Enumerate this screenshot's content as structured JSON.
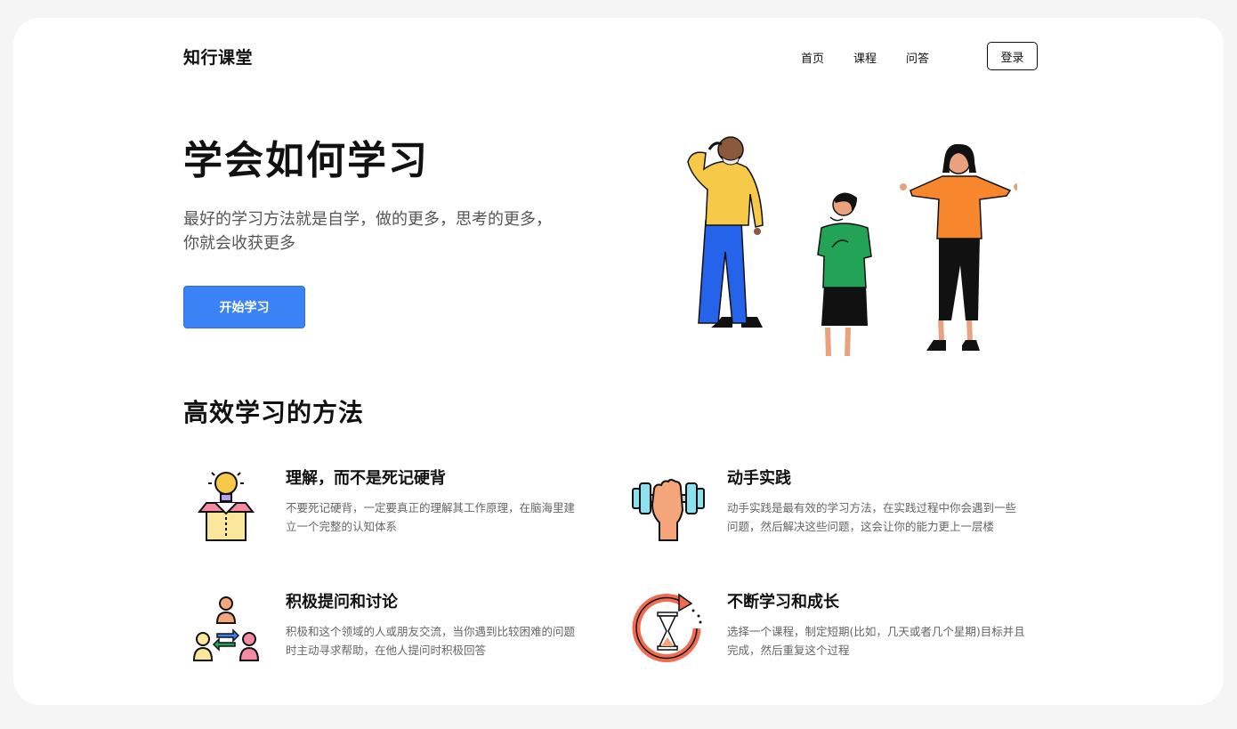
{
  "header": {
    "logo": "知行课堂",
    "nav": [
      {
        "label": "首页"
      },
      {
        "label": "课程"
      },
      {
        "label": "问答"
      }
    ],
    "login_label": "登录"
  },
  "hero": {
    "title": "学会如何学习",
    "subtitle_line1": "最好的学习方法就是自学，做的更多，思考的更多，",
    "subtitle_line2": "你就会收获更多",
    "cta_label": "开始学习"
  },
  "methods": {
    "title": "高效学习的方法",
    "items": [
      {
        "icon": "lightbulb-box-icon",
        "title": "理解，而不是死记硬背",
        "desc_line1": "不要死记硬背，一定要真正的理解其工作原理，在脑海里建",
        "desc_line2": "立一个完整的认知体系"
      },
      {
        "icon": "dumbbell-hand-icon",
        "title": "动手实践",
        "desc_line1": "动手实践是最有效的学习方法，在实践过程中你会遇到一些",
        "desc_line2": "问题，然后解决这些问题，这会让你的能力更上一层楼"
      },
      {
        "icon": "discussion-people-icon",
        "title": "积极提问和讨论",
        "desc_line1": "积极和这个领域的人或朋友交流，当你遇到比较困难的问题",
        "desc_line2": "时主动寻求帮助，在他人提问时积极回答"
      },
      {
        "icon": "hourglass-cycle-icon",
        "title": "不断学习和成长",
        "desc_line1": "选择一个课程，制定短期(比如，几天或者几个星期)目标并且",
        "desc_line2": "完成，然后重复这个过程"
      }
    ]
  },
  "colors": {
    "accent": "#3b82f6",
    "background": "#f5f5f5",
    "card": "#ffffff"
  }
}
